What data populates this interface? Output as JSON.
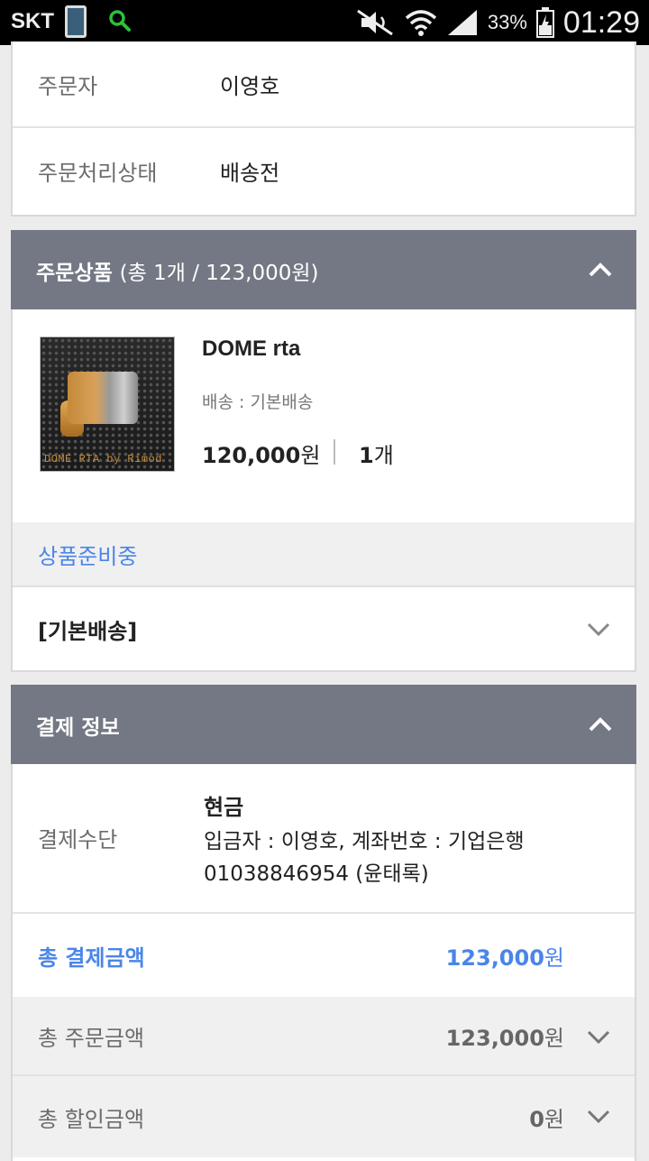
{
  "status_bar": {
    "carrier": "SKT",
    "battery_pct": "33%",
    "time": "01:29"
  },
  "order_info": {
    "orderer_label": "주문자",
    "orderer_value": "이영호",
    "status_label": "주문처리상태",
    "status_value": "배송전"
  },
  "order_items": {
    "header_title": "주문상품",
    "header_summary": "(총 1개 / 123,000원)",
    "product": {
      "name": "DOME rta",
      "shipping": "배송 : 기본배송",
      "price": "120,000",
      "price_unit": "원",
      "qty": "1",
      "qty_unit": "개",
      "image_caption": "DOME RTA by Rimod"
    },
    "preparing_status": "상품준비중",
    "shipping_group": "[기본배송]"
  },
  "payment": {
    "header_title": "결제 정보",
    "method_label": "결제수단",
    "method_value": "현금",
    "method_detail_line1": "입금자 : 이영호, 계좌번호 : 기업은행",
    "method_detail_line2": "01038846954 (윤태록)",
    "total_payment_label": "총 결제금액",
    "total_payment_value": "123,000",
    "total_payment_unit": "원",
    "total_order_label": "총 주문금액",
    "total_order_value": "123,000",
    "total_order_unit": "원",
    "total_discount_label": "총 할인금액",
    "total_discount_value": "0",
    "total_discount_unit": "원"
  },
  "colors": {
    "header_bg": "#737884",
    "accent_blue": "#4a86e8"
  }
}
